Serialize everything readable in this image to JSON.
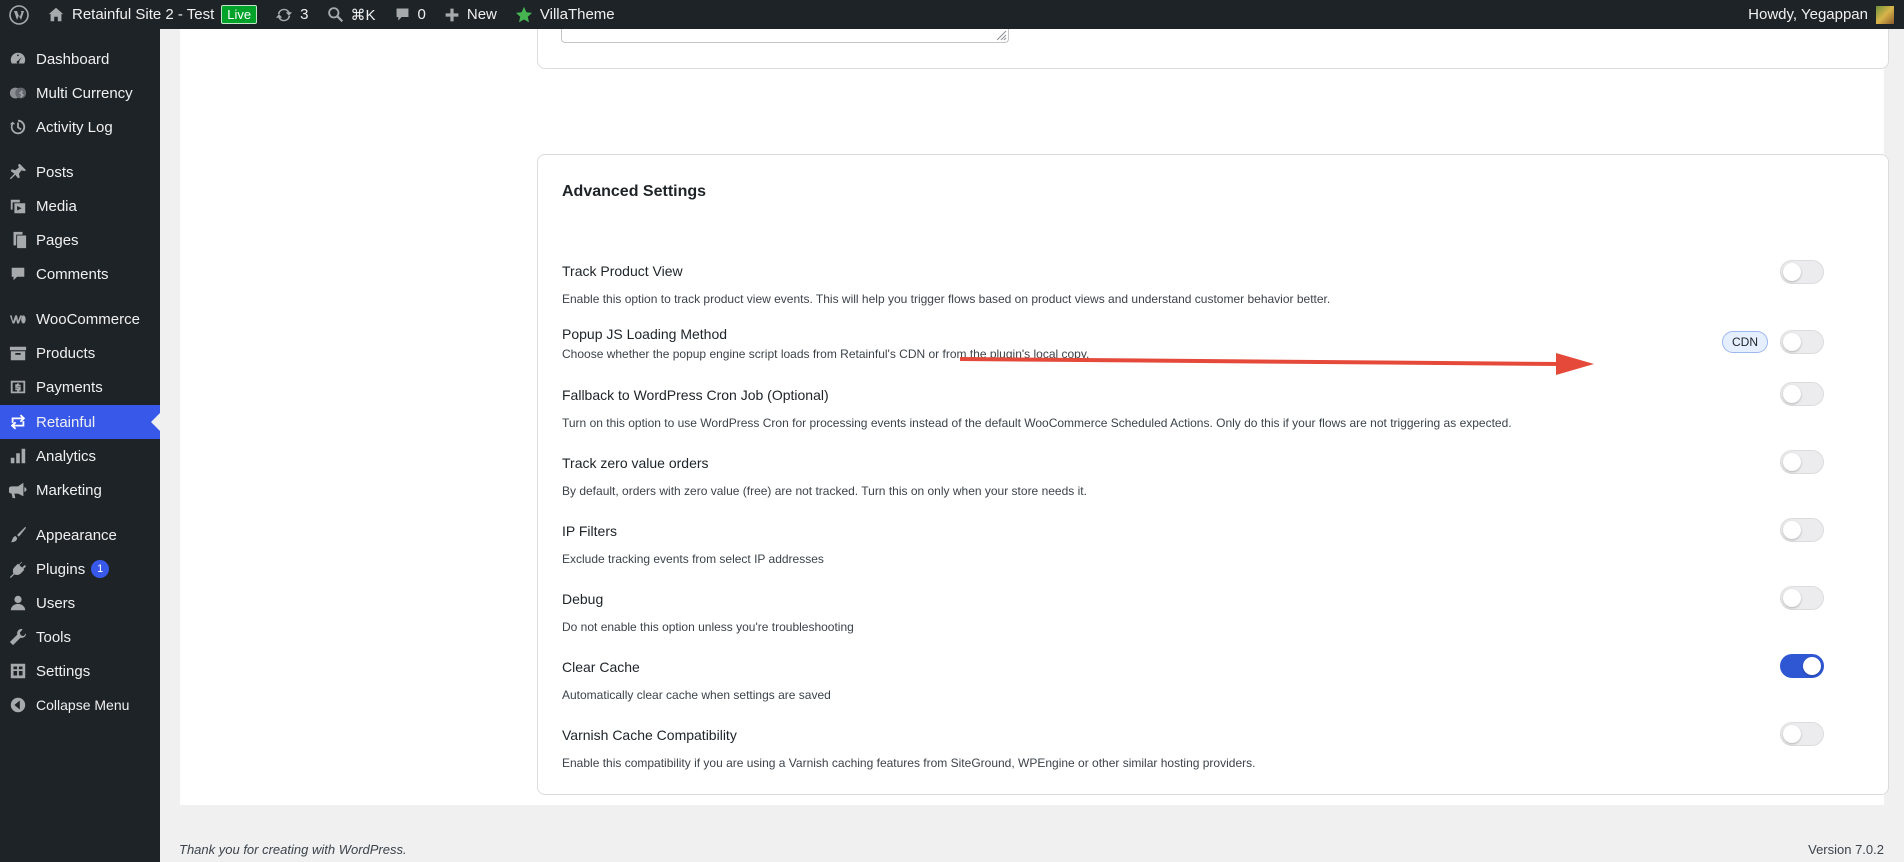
{
  "admin_bar": {
    "site_name": "Retainful Site 2 - Test",
    "live_label": "Live",
    "updates_count": "3",
    "search_shortcut": "⌘K",
    "comments_count": "0",
    "new_label": "New",
    "villatheme_label": "VillaTheme",
    "howdy": "Howdy, Yegappan"
  },
  "sidebar": {
    "items": [
      {
        "label": "Dashboard",
        "icon": "dashboard-icon"
      },
      {
        "label": "Multi Currency",
        "icon": "currency-icon"
      },
      {
        "label": "Activity Log",
        "icon": "activity-log-icon"
      },
      {
        "label": "Posts",
        "icon": "pin-icon"
      },
      {
        "label": "Media",
        "icon": "media-icon"
      },
      {
        "label": "Pages",
        "icon": "pages-icon"
      },
      {
        "label": "Comments",
        "icon": "comment-icon"
      },
      {
        "label": "WooCommerce",
        "icon": "woocommerce-icon"
      },
      {
        "label": "Products",
        "icon": "archive-icon"
      },
      {
        "label": "Payments",
        "icon": "payments-icon"
      },
      {
        "label": "Retainful",
        "icon": "retainful-icon"
      },
      {
        "label": "Analytics",
        "icon": "analytics-icon"
      },
      {
        "label": "Marketing",
        "icon": "megaphone-icon"
      },
      {
        "label": "Appearance",
        "icon": "brush-icon"
      },
      {
        "label": "Plugins",
        "icon": "plugin-icon",
        "badge": "1"
      },
      {
        "label": "Users",
        "icon": "user-icon"
      },
      {
        "label": "Tools",
        "icon": "wrench-icon"
      },
      {
        "label": "Settings",
        "icon": "settings-icon"
      },
      {
        "label": "Collapse Menu",
        "icon": "collapse-icon"
      }
    ]
  },
  "advanced": {
    "title": "Advanced Settings",
    "settings": [
      {
        "label": "Track Product View",
        "desc": "Enable this option to track product view events. This will help you trigger flows based on product views and understand customer behavior better.",
        "enabled": false
      },
      {
        "label": "Popup JS Loading Method",
        "desc": "Choose whether the popup engine script loads from Retainful's CDN or from the plugin's local copy.",
        "enabled": false,
        "badge": "CDN"
      },
      {
        "label": "Fallback to WordPress Cron Job (Optional)",
        "desc": "Turn on this option to use WordPress Cron for processing events instead of the default WooCommerce Scheduled Actions. Only do this if your flows are not triggering as expected.",
        "enabled": false
      },
      {
        "label": "Track zero value orders",
        "desc": "By default, orders with zero value (free) are not tracked. Turn this on only when your store needs it.",
        "enabled": false
      },
      {
        "label": "IP Filters",
        "desc": "Exclude tracking events from select IP addresses",
        "enabled": false
      },
      {
        "label": "Debug",
        "desc": "Do not enable this option unless you're troubleshooting",
        "enabled": false
      },
      {
        "label": "Clear Cache",
        "desc": "Automatically clear cache when settings are saved",
        "enabled": true
      },
      {
        "label": "Varnish Cache Compatibility",
        "desc": "Enable this compatibility if you are using a Varnish caching features from SiteGround, WPEngine or other similar hosting providers.",
        "enabled": false
      }
    ]
  },
  "annotation": {
    "arrow_color": "#e5493a"
  },
  "colors": {
    "accent": "#3858e9",
    "toggle_on": "#2f57d4"
  },
  "footer": {
    "thanks": "Thank you for creating with WordPress.",
    "version": "Version 7.0.2"
  }
}
